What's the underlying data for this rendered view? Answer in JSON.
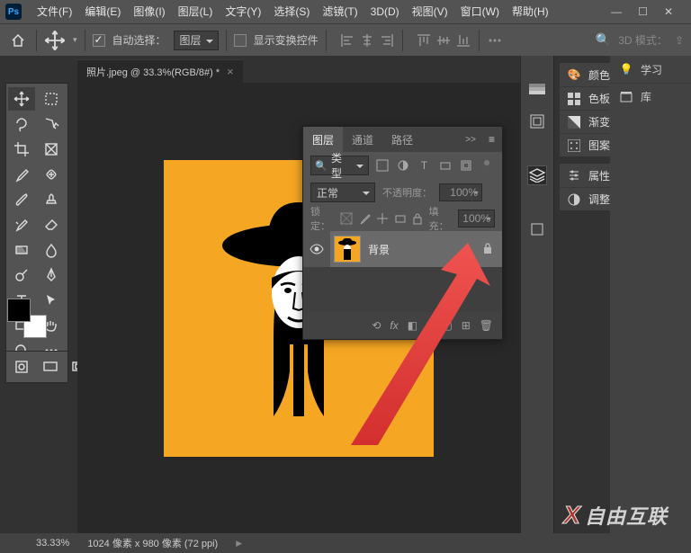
{
  "app": {
    "logo": "Ps"
  },
  "menu": {
    "file": "文件(F)",
    "edit": "编辑(E)",
    "image": "图像(I)",
    "layer": "图层(L)",
    "type": "文字(Y)",
    "select": "选择(S)",
    "filter": "滤镜(T)",
    "threeD": "3D(D)",
    "view": "视图(V)",
    "window": "窗口(W)",
    "help": "帮助(H)"
  },
  "options": {
    "auto_select_label": "自动选择：",
    "auto_select_target": "图层",
    "show_transform_label": "显示变换控件",
    "threeD_mode_label": "3D 模式："
  },
  "document": {
    "tab_title": "照片.jpeg @ 33.3%(RGB/8#) *"
  },
  "layers_panel": {
    "tabs": {
      "layers": "图层",
      "channels": "通道",
      "paths": "路径"
    },
    "collapse": ">>",
    "kind_label": "类型",
    "blend_mode": "正常",
    "opacity_label": "不透明度：",
    "opacity_value": "100%",
    "lock_label": "锁定：",
    "fill_label": "填充：",
    "fill_value": "100%",
    "layer_name": "背景"
  },
  "right_panels": {
    "color": "颜色",
    "swatches": "色板",
    "gradient": "渐变",
    "pattern": "图案",
    "properties": "属性",
    "adjust": "调整",
    "learn": "学习",
    "library": "库"
  },
  "status": {
    "zoom": "33.33%",
    "dims": "1024 像素 x 980 像素 (72 ppi)"
  },
  "watermark": {
    "x": "X",
    "text": "自由互联"
  }
}
